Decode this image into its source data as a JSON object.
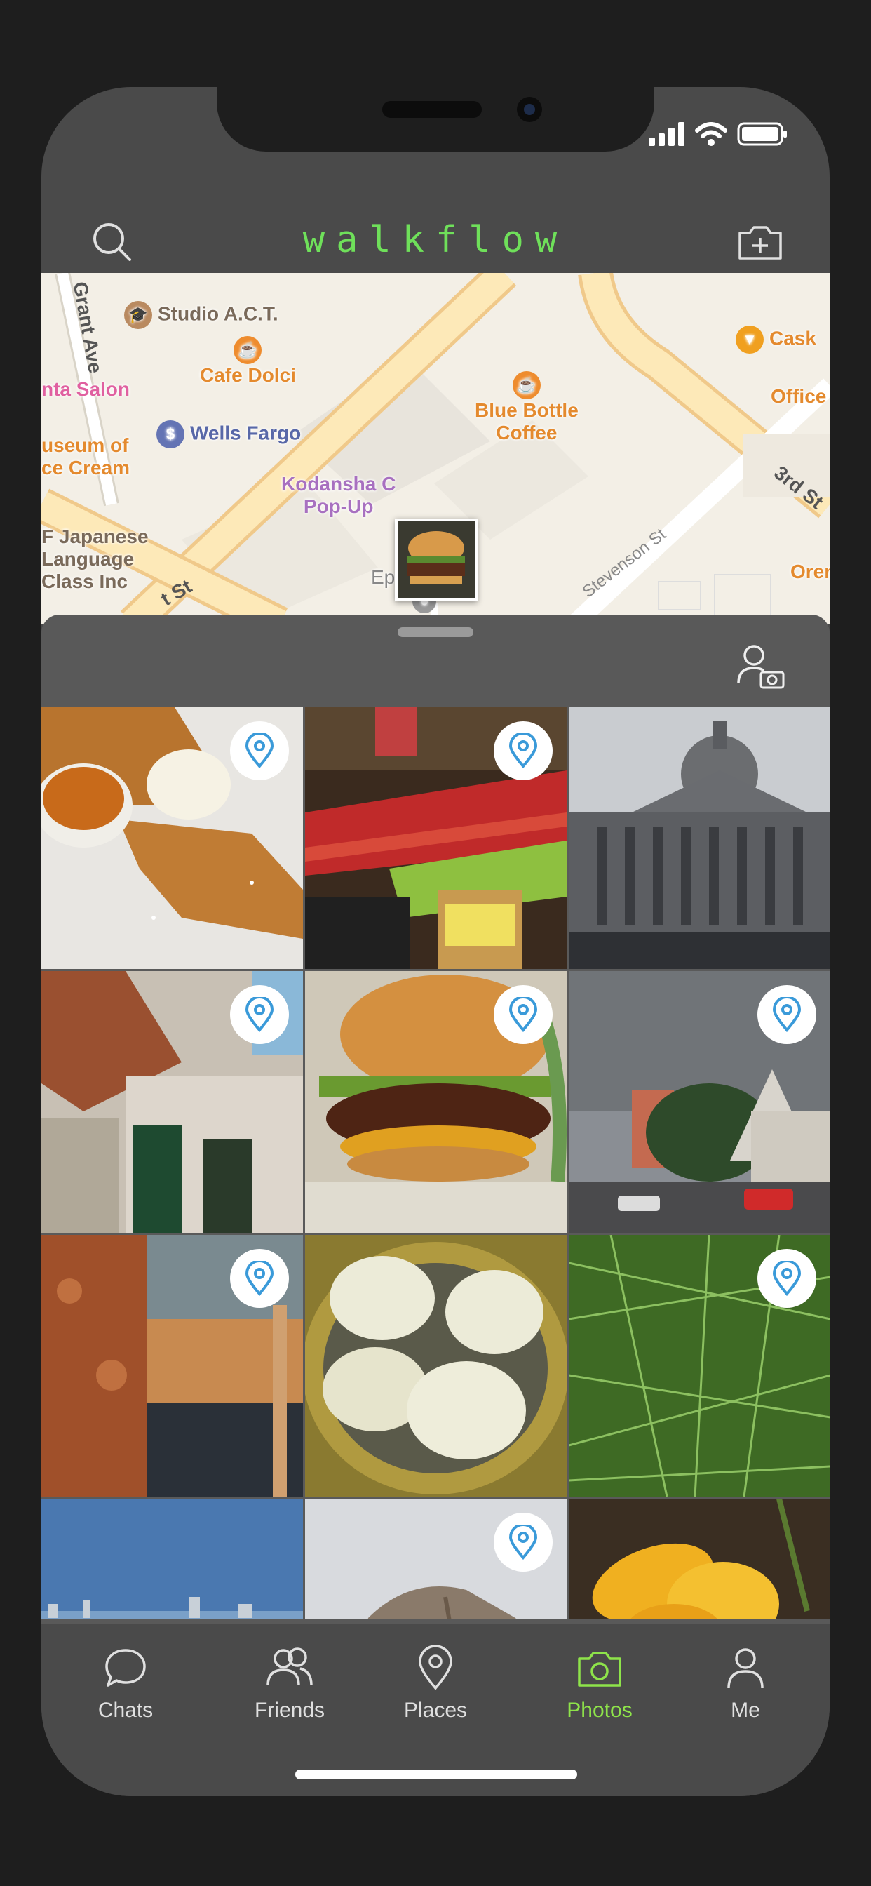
{
  "app": {
    "title": "walkflow"
  },
  "header": {
    "search_icon": "search-icon",
    "add_photo_icon": "camera-plus-icon"
  },
  "map": {
    "pois": [
      {
        "label": "Studio A.C.T.",
        "color": "#8a6a4a"
      },
      {
        "label": "Cafe Dolci",
        "color": "#e48a2e"
      },
      {
        "label": "Wells Fargo",
        "color": "#5868a8"
      },
      {
        "label": "Blue Bottle\nCoffee",
        "color": "#e48a2e"
      },
      {
        "label": "Kodansha C\nPop-Up",
        "color": "#a870c0"
      },
      {
        "label": "Epic Church",
        "color": "#8a8a8a"
      },
      {
        "label": "Cask",
        "color": "#e48a2e"
      },
      {
        "label": "Office",
        "color": "#e48a2e"
      },
      {
        "label": "Oren",
        "color": "#e48a2e"
      },
      {
        "label": "nta Salon",
        "color": "#e060a0"
      },
      {
        "label": "useum of\nce Cream",
        "color": "#e48a2e"
      },
      {
        "label": "F Japanese\nLanguage\nClass Inc",
        "color": "#8a6a4a"
      }
    ],
    "streets": [
      "Grant Ave",
      "3rd St",
      "Stevenson St",
      "t St"
    ]
  },
  "tabs": [
    {
      "label": "Chats",
      "icon": "chat-bubble-icon"
    },
    {
      "label": "Friends",
      "icon": "friends-icon"
    },
    {
      "label": "Places",
      "icon": "location-pin-icon"
    },
    {
      "label": "Photos",
      "icon": "camera-icon",
      "active": true
    },
    {
      "label": "Me",
      "icon": "person-icon"
    }
  ],
  "photos": [
    {
      "name": "french-toast",
      "pinned": true
    },
    {
      "name": "apples-produce",
      "pinned": true
    },
    {
      "name": "city-hall",
      "pinned": false
    },
    {
      "name": "old-building",
      "pinned": true
    },
    {
      "name": "burger",
      "pinned": true
    },
    {
      "name": "victorian-houses",
      "pinned": true
    },
    {
      "name": "copper-interior",
      "pinned": true
    },
    {
      "name": "dumplings",
      "pinned": false
    },
    {
      "name": "green-plants",
      "pinned": true
    },
    {
      "name": "skyline",
      "pinned": false
    },
    {
      "name": "half-dome",
      "pinned": true
    },
    {
      "name": "yellow-flower",
      "pinned": false
    }
  ],
  "colors": {
    "accent": "#8ee34a",
    "title": "#6fe05a",
    "pin": "#3a9ad9"
  }
}
